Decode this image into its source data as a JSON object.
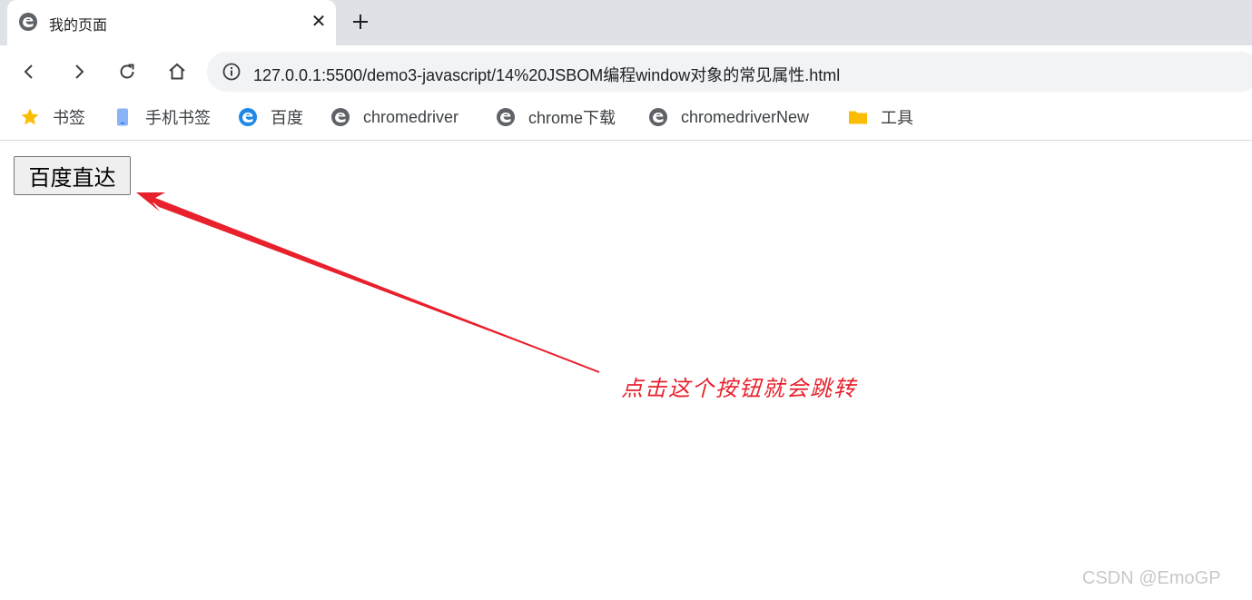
{
  "tab": {
    "title": "我的页面",
    "close": "✕",
    "favicon": "edge-icon"
  },
  "toolbar": {
    "url": "127.0.0.1:5500/demo3-javascript/14%20JSBOM编程window对象的常见属性.html",
    "icons": [
      "back-icon",
      "forward-icon",
      "reload-icon",
      "home-icon",
      "info-icon"
    ]
  },
  "bookmarks": [
    {
      "label": "书签",
      "icon": "star-icon"
    },
    {
      "label": "手机书签",
      "icon": "phone-icon"
    },
    {
      "label": "百度",
      "icon": "edge-icon"
    },
    {
      "label": "chromedriver",
      "icon": "edge-icon"
    },
    {
      "label": "chrome下载",
      "icon": "edge-icon"
    },
    {
      "label": "chromedriverNew",
      "icon": "edge-icon"
    },
    {
      "label": "工具",
      "icon": "folder-icon"
    }
  ],
  "content": {
    "button_label": "百度直达",
    "annotation": "点击这个按钮就会跳转"
  },
  "watermark": "CSDN @EmoGP",
  "colors": {
    "annotation": "#e8212c",
    "tabstrip": "#dee1e6",
    "omnibox": "#f1f3f4"
  }
}
